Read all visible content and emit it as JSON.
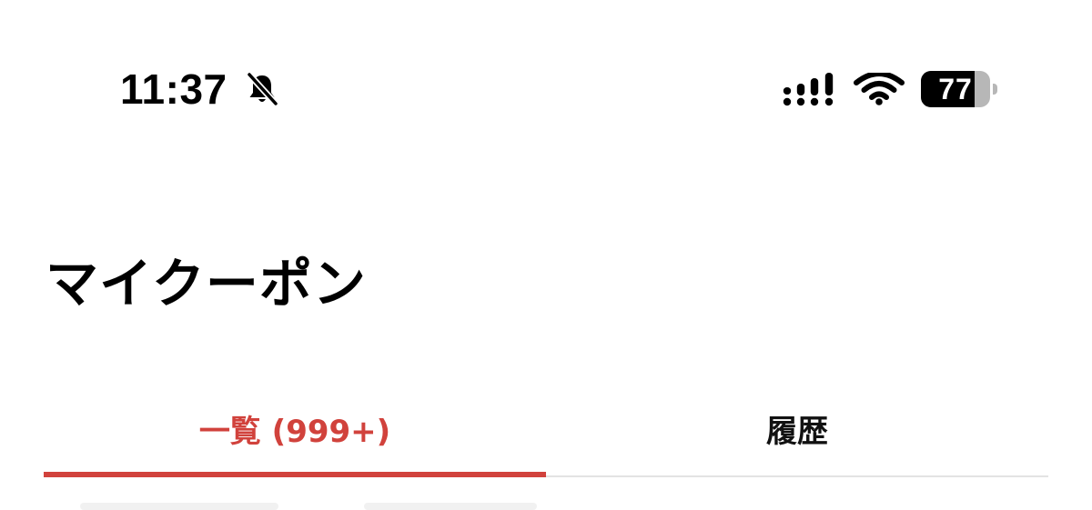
{
  "status_bar": {
    "time": "11:37",
    "battery_level": "77",
    "battery_percent": 77,
    "icons": [
      "bell-slash-icon",
      "cellular-signal-icon",
      "wifi-icon",
      "battery-icon"
    ]
  },
  "page": {
    "title": "マイクーポン"
  },
  "tabs": [
    {
      "label": "一覧 (999+)",
      "active": true
    },
    {
      "label": "履歴",
      "active": false
    }
  ],
  "colors": {
    "accent": "#d1423c",
    "text": "#000000",
    "divider": "#e3e3e3",
    "battery_track": "#b7b7b7"
  }
}
